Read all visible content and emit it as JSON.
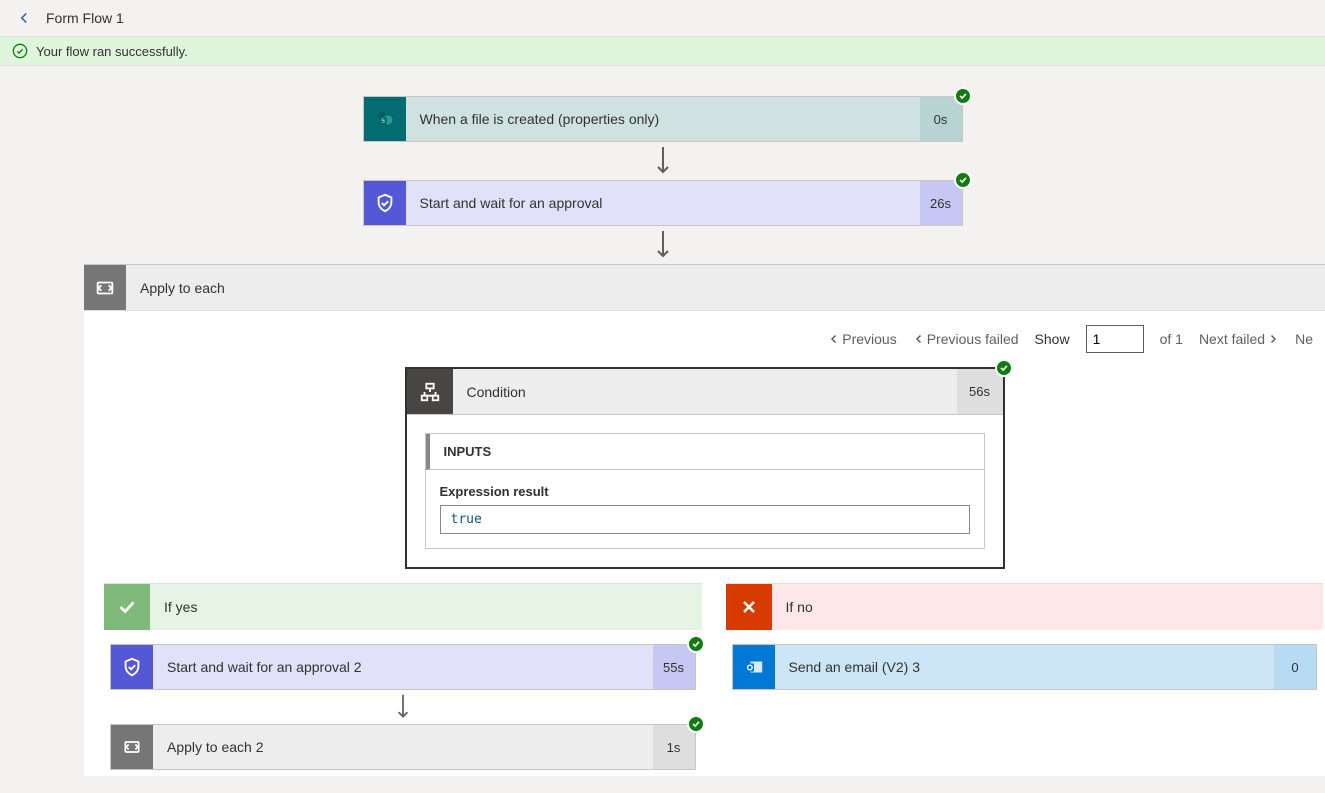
{
  "header": {
    "title": "Form Flow 1"
  },
  "success": {
    "message": "Your flow ran successfully."
  },
  "trigger": {
    "label": "When a file is created (properties only)",
    "duration": "0s"
  },
  "approval1": {
    "label": "Start and wait for an approval",
    "duration": "26s"
  },
  "apply_each": {
    "label": "Apply to each"
  },
  "pager": {
    "previous": "Previous",
    "previous_failed": "Previous failed",
    "show": "Show",
    "value": "1",
    "of_total": "of 1",
    "next_failed": "Next failed",
    "next": "Ne"
  },
  "condition": {
    "label": "Condition",
    "duration": "56s",
    "inputs_header": "INPUTS",
    "expr_label": "Expression result",
    "expr_value": "true"
  },
  "branches": {
    "yes": {
      "label": "If yes",
      "approval": {
        "label": "Start and wait for an approval 2",
        "duration": "55s"
      },
      "apply": {
        "label": "Apply to each 2",
        "duration": "1s"
      }
    },
    "no": {
      "label": "If no",
      "email": {
        "label": "Send an email (V2) 3",
        "duration": "0"
      }
    }
  }
}
